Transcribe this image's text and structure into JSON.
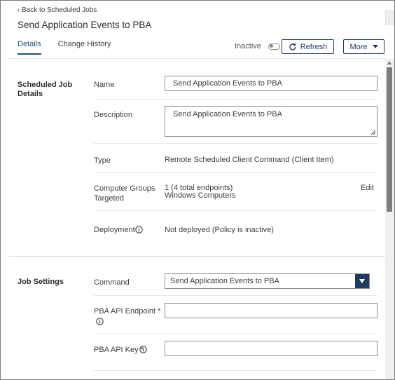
{
  "header": {
    "back_link": "Back to Scheduled Jobs",
    "title": "Send Application Events to PBA"
  },
  "tabs": [
    {
      "label": "Details",
      "active": true
    },
    {
      "label": "Change History",
      "active": false
    }
  ],
  "toolbar": {
    "status_label": "Inactive",
    "status_active": false,
    "refresh_label": "Refresh",
    "more_label": "More"
  },
  "details": {
    "section_title": "Scheduled Job Details",
    "name_label": "Name",
    "name_value": "Send Application Events to PBA",
    "description_label": "Description",
    "description_value": "Send Application Events to PBA",
    "type_label": "Type",
    "type_value": "Remote Scheduled Client Command (Client Item)",
    "groups_label": "Computer Groups Targeted",
    "groups_count": "1 (4 total endpoints)",
    "groups_name": "Windows Computers",
    "groups_edit": "Edit",
    "deployment_label": "Deployment",
    "deployment_value": "Not deployed (Policy is inactive)"
  },
  "job_settings": {
    "section_title": "Job Settings",
    "command_label": "Command",
    "command_value": "Send Application Events to PBA",
    "endpoint_label": "PBA API Endpoint *",
    "endpoint_value": "",
    "apikey_label": "PBA API Key *",
    "apikey_value": ""
  },
  "colors": {
    "accent": "#1f3a5f",
    "tab_active": "#1f4e79",
    "border": "#8c8c8c"
  }
}
